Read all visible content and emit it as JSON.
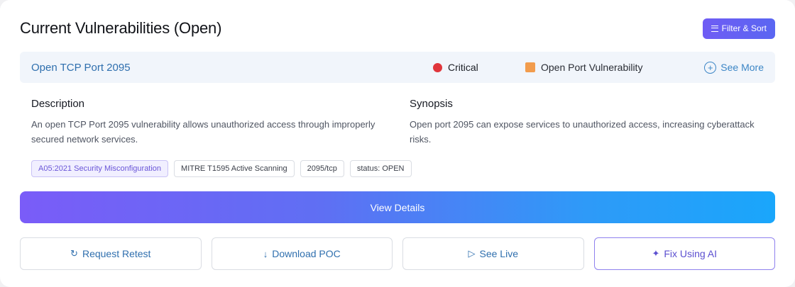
{
  "header": {
    "title": "Current Vulnerabilities (Open)",
    "filter_label": "Filter & Sort"
  },
  "vulnerability": {
    "name": "Open TCP Port 2095",
    "severity": "Critical",
    "severity_color": "#e0353b",
    "category": "Open Port Vulnerability",
    "category_color": "#f29c4d",
    "see_more_label": "See More"
  },
  "description": {
    "heading": "Description",
    "text": "An open TCP Port 2095 vulnerability allows unauthorized access through improperly secured network services."
  },
  "synopsis": {
    "heading": "Synopsis",
    "text": "Open port 2095 can expose services to unauthorized access, increasing cyberattack risks."
  },
  "tags": [
    "A05:2021 Security Misconfiguration",
    "MITRE T1595 Active Scanning",
    "2095/tcp",
    "status: OPEN"
  ],
  "view_details_label": "View Details",
  "actions": {
    "retest": {
      "icon": "↻",
      "label": "Request Retest"
    },
    "download": {
      "icon": "↓",
      "label": "Download POC"
    },
    "live": {
      "icon": "▷",
      "label": "See Live"
    },
    "fix_ai": {
      "icon": "✦",
      "label": "Fix Using AI"
    }
  },
  "colors": {
    "accent": "#6f5cf4",
    "link": "#2f6fae",
    "gradient_start": "#7a5cf8",
    "gradient_end": "#1aa6fb"
  }
}
